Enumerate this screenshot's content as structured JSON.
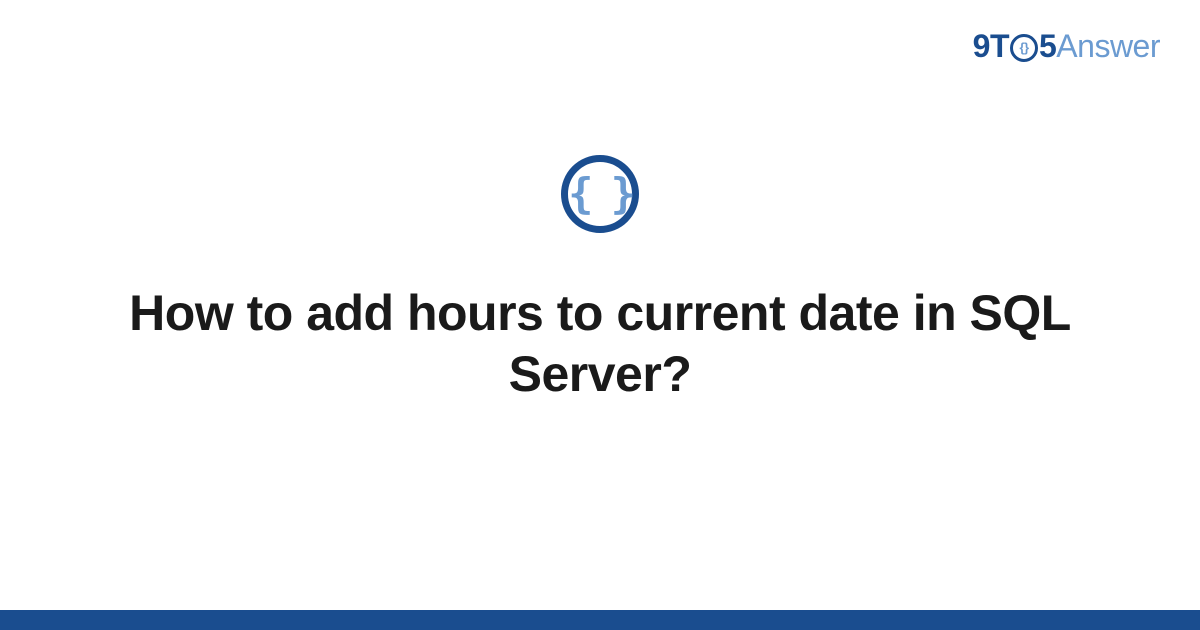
{
  "logo": {
    "prefix": "9T",
    "o_inner": "{}",
    "five": "5",
    "suffix": "Answer"
  },
  "badge": {
    "symbol": "{ }"
  },
  "main": {
    "title": "How to add hours to current date in SQL Server?"
  },
  "colors": {
    "brand_dark": "#1a4d8f",
    "brand_light": "#6b9bd1"
  }
}
